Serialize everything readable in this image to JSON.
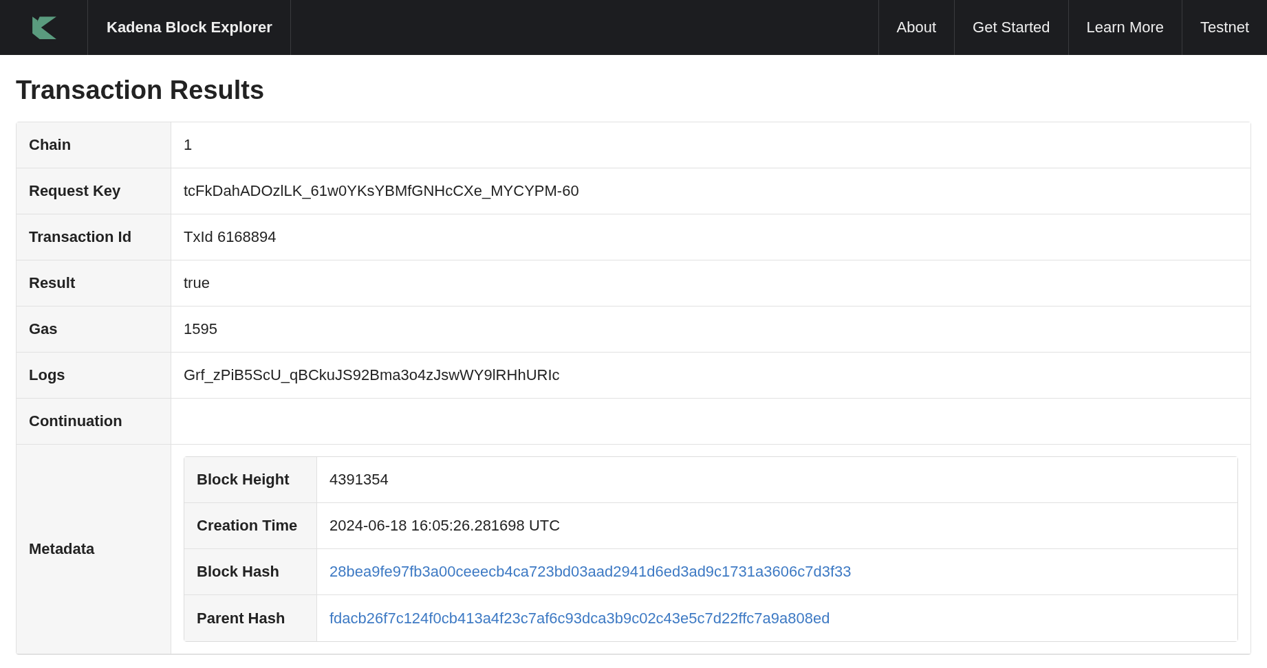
{
  "navbar": {
    "brand": "Kadena Block Explorer",
    "links": [
      "About",
      "Get Started",
      "Learn More",
      "Testnet"
    ]
  },
  "title": "Transaction Results",
  "rows": [
    {
      "label": "Chain",
      "kind": "text",
      "value": "1"
    },
    {
      "label": "Request Key",
      "kind": "text",
      "value": "tcFkDahADOzlLK_61w0YKsYBMfGNHcCXe_MYCYPM-60"
    },
    {
      "label": "Transaction Id",
      "kind": "text",
      "value": "TxId 6168894"
    },
    {
      "label": "Result",
      "kind": "text",
      "value": "true"
    },
    {
      "label": "Gas",
      "kind": "text",
      "value": "1595"
    },
    {
      "label": "Logs",
      "kind": "text",
      "value": "Grf_zPiB5ScU_qBCkuJS92Bma3o4zJswWY9lRHhURIc"
    },
    {
      "label": "Continuation",
      "kind": "empty"
    },
    {
      "label": "Metadata",
      "kind": "table",
      "rows": [
        {
          "label": "Block Height",
          "kind": "text",
          "value": "4391354"
        },
        {
          "label": "Creation Time",
          "kind": "text",
          "value": "2024-06-18 16:05:26.281698 UTC"
        },
        {
          "label": "Block Hash",
          "kind": "link",
          "value": "28bea9fe97fb3a00ceeecb4ca723bd03aad2941d6ed3ad9c1731a3606c7d3f33"
        },
        {
          "label": "Parent Hash",
          "kind": "link",
          "value": "fdacb26f7c124f0cb413a4f23c7af6c93dca3b9c02c43e5c7d22ffc7a9a808ed"
        }
      ]
    }
  ]
}
